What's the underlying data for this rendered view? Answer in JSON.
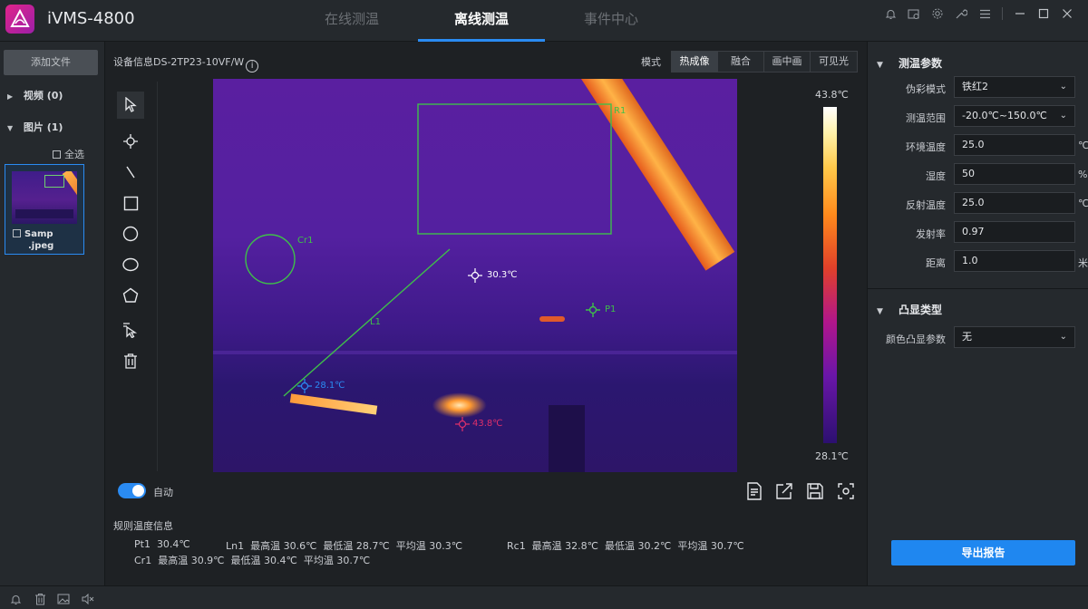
{
  "app": {
    "title": "iVMS-4800"
  },
  "tabs": [
    {
      "label": "在线测温",
      "active": false
    },
    {
      "label": "离线测温",
      "active": true
    },
    {
      "label": "事件中心",
      "active": false
    }
  ],
  "window_icons": [
    "bell-icon",
    "image-settings-icon",
    "gear-icon",
    "wrench-icon",
    "menu-icon",
    "minimize-icon",
    "maximize-icon",
    "close-icon"
  ],
  "left": {
    "add_file": "添加文件",
    "video": {
      "label": "视频",
      "count": "(0)"
    },
    "images": {
      "label": "图片",
      "count": "(1)"
    },
    "select_all": "全选",
    "thumbnail": {
      "name_line1": "Samp",
      "name_line2": ".jpeg"
    }
  },
  "center": {
    "device_info": "设备信息DS-2TP23-10VF/W",
    "mode_label": "模式",
    "modes": [
      "热成像",
      "融合",
      "画中画",
      "可见光"
    ],
    "active_mode": "热成像",
    "tools": [
      "select-arrow-icon",
      "point-tool-icon",
      "line-tool-icon",
      "rectangle-tool-icon",
      "circle-tool-icon",
      "ellipse-tool-icon",
      "polygon-tool-icon",
      "clear-select-icon",
      "delete-icon"
    ],
    "overlays": {
      "R1": "R1",
      "Cr1": "Cr1",
      "L1": "L1",
      "P1": "P1",
      "center_temp": "30.3℃",
      "min_temp": "28.1℃",
      "max_temp": "43.8℃"
    },
    "colorbar": {
      "max": "43.8℃",
      "min": "28.1℃"
    },
    "auto_label": "自动",
    "auto_on": true,
    "bottom_actions": [
      "report-icon",
      "edit-export-icon",
      "save-icon",
      "screenshot-icon"
    ],
    "rule_info": {
      "title": "规则温度信息",
      "pt1": "Pt1  30.4℃",
      "ln1": "Ln1  最高温 30.6℃  最低温 28.7℃  平均温 30.3℃",
      "rc1": "Rc1  最高温 32.8℃  最低温 30.2℃  平均温 30.7℃",
      "cr1": "Cr1  最高温 30.9℃  最低温 30.4℃  平均温 30.7℃"
    }
  },
  "right": {
    "section1": "测温参数",
    "params": [
      {
        "label": "伪彩模式",
        "value": "铁红2",
        "dropdown": true,
        "unit": ""
      },
      {
        "label": "测温范围",
        "value": "-20.0℃~150.0℃",
        "dropdown": true,
        "unit": ""
      },
      {
        "label": "环境温度",
        "value": "25.0",
        "dropdown": false,
        "unit": "℃"
      },
      {
        "label": "湿度",
        "value": "50",
        "dropdown": false,
        "unit": "%"
      },
      {
        "label": "反射温度",
        "value": "25.0",
        "dropdown": false,
        "unit": "℃"
      },
      {
        "label": "发射率",
        "value": "0.97",
        "dropdown": false,
        "unit": ""
      },
      {
        "label": "距离",
        "value": "1.0",
        "dropdown": false,
        "unit": "米"
      }
    ],
    "section2": "凸显类型",
    "highlight": {
      "label": "颜色凸显参数",
      "value": "无"
    },
    "export": "导出报告"
  },
  "statusbar_icons": [
    "bell-icon",
    "trash-icon",
    "image-icon",
    "mute-icon"
  ],
  "colors": {
    "accent": "#2a8bf2",
    "overlay_green": "#3fbf4a",
    "background": "#1e2124",
    "panel": "#25292d"
  }
}
